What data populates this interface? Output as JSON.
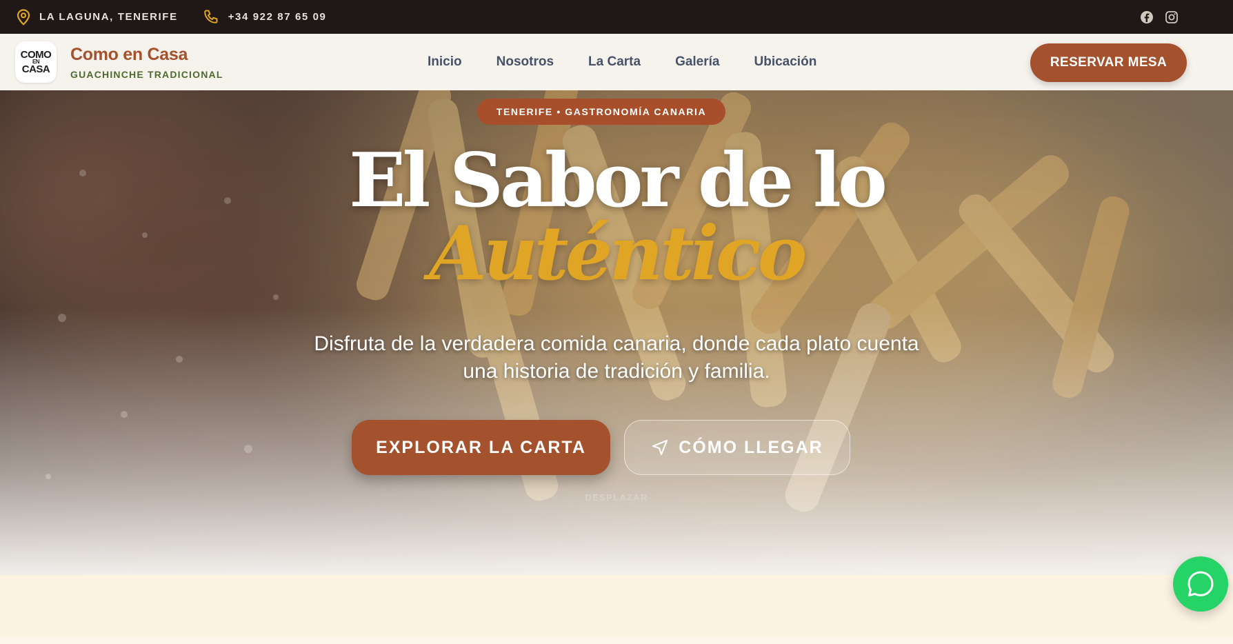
{
  "topbar": {
    "location": "LA LAGUNA, TENERIFE",
    "phone": "+34 922 87 65 09",
    "icons": [
      "map-pin-icon",
      "phone-icon",
      "facebook-icon",
      "instagram-icon"
    ]
  },
  "nav": {
    "logo_lines": [
      "COMO",
      "EN",
      "CASA"
    ],
    "brand_name": "Como en Casa",
    "brand_tagline": "GUACHINCHE TRADICIONAL",
    "links": [
      "Inicio",
      "Nosotros",
      "La Carta",
      "Galería",
      "Ubicación"
    ],
    "cta": "RESERVAR MESA"
  },
  "hero": {
    "badge": "TENERIFE • GASTRONOMÍA CANARIA",
    "title_line1": "El Sabor de lo",
    "title_line2": "Auténtico",
    "subtitle": "Disfruta de la verdadera comida canaria, donde cada plato cuenta una historia de tradición y familia.",
    "primary_button": "EXPLORAR LA CARTA",
    "secondary_button": "CÓMO LLEGAR",
    "scroll_hint": "DESPLAZAR"
  },
  "colors": {
    "topbar_bg": "#1f1816",
    "accent_terracotta": "#a4512e",
    "accent_gold": "#e0a525",
    "tagline_green": "#4c6b2f",
    "whatsapp_green": "#25d366"
  }
}
